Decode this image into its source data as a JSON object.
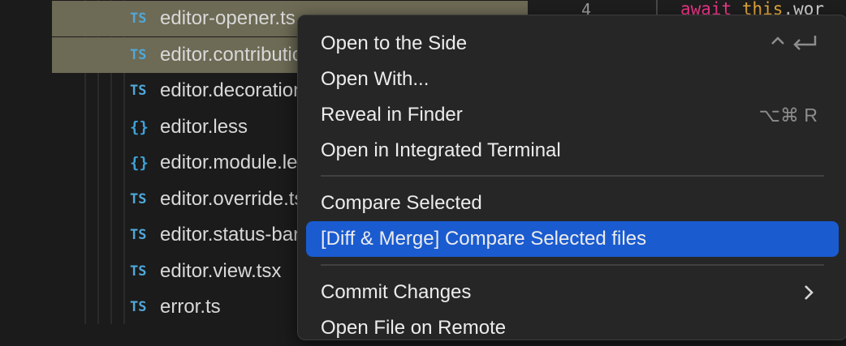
{
  "explorer": {
    "files": [
      {
        "icon": "TS",
        "type": "ts",
        "name": "editor-opener.ts",
        "selected": true
      },
      {
        "icon": "TS",
        "type": "ts",
        "name": "editor.contribution.ts",
        "selected": true
      },
      {
        "icon": "TS",
        "type": "ts",
        "name": "editor.decoration.ts",
        "selected": false
      },
      {
        "icon": "{}",
        "type": "css",
        "name": "editor.less",
        "selected": false
      },
      {
        "icon": "{}",
        "type": "css",
        "name": "editor.module.less",
        "selected": false
      },
      {
        "icon": "TS",
        "type": "ts",
        "name": "editor.override.ts",
        "selected": false
      },
      {
        "icon": "TS",
        "type": "ts",
        "name": "editor.status-bar.ts",
        "selected": false
      },
      {
        "icon": "TS",
        "type": "ts",
        "name": "editor.view.tsx",
        "selected": false
      },
      {
        "icon": "TS",
        "type": "ts",
        "name": "error.ts",
        "selected": false
      }
    ]
  },
  "editor": {
    "line_number": "4",
    "code": {
      "keyword": "await",
      "this_kw": "this",
      "dot": ".",
      "rest": "wor"
    }
  },
  "context_menu": {
    "open_side": {
      "label": "Open to the Side",
      "shortcut": "^"
    },
    "open_with": {
      "label": "Open With..."
    },
    "reveal": {
      "label": "Reveal in Finder",
      "shortcut": "⌥⌘ R"
    },
    "open_terminal": {
      "label": "Open in Integrated Terminal"
    },
    "compare_selected": {
      "label": "Compare Selected"
    },
    "diff_merge": {
      "label": "[Diff & Merge] Compare Selected files",
      "highlighted": true
    },
    "commit_changes": {
      "label": "Commit Changes"
    },
    "open_remote": {
      "label": "Open File on Remote"
    }
  },
  "colors": {
    "menu_highlight": "#1a5bd0",
    "selection_row": "#6d6a55",
    "ts_icon": "#4fa8da",
    "keyword": "#f0378a"
  }
}
